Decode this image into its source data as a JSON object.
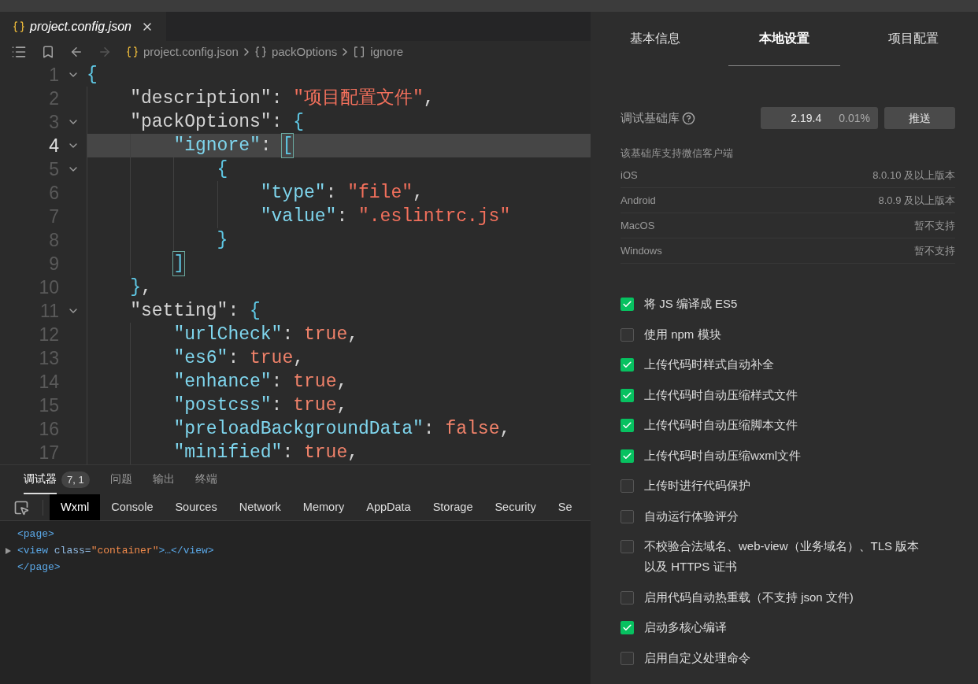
{
  "editor": {
    "tab": {
      "label": "project.config.json",
      "selected": true
    },
    "breadcrumb": [
      {
        "kind": "file",
        "label": "project.config.json"
      },
      {
        "kind": "object",
        "label": "packOptions"
      },
      {
        "kind": "array",
        "label": "ignore"
      }
    ],
    "lines": [
      {
        "number": "1",
        "foldable": true,
        "current": false,
        "tokens": [
          {
            "kind": "brace",
            "text": "{"
          }
        ],
        "children": [
          {
            "number": "2",
            "foldable": false,
            "current": false,
            "tokens": [
              {
                "kind": "key",
                "text": "\"description\""
              },
              {
                "kind": "punct",
                "text": ": "
              },
              {
                "kind": "string",
                "text": "\"项目配置文件\""
              },
              {
                "kind": "punct",
                "text": ","
              }
            ]
          },
          {
            "number": "3",
            "foldable": true,
            "current": false,
            "tokens": [
              {
                "kind": "key",
                "text": "\"packOptions\""
              },
              {
                "kind": "punct",
                "text": ": "
              },
              {
                "kind": "brace",
                "text": "{"
              }
            ],
            "children": [
              {
                "number": "4",
                "foldable": true,
                "current": true,
                "tokens": [
                  {
                    "kind": "prop",
                    "text": "\"ignore\""
                  },
                  {
                    "kind": "punct",
                    "text": ": "
                  },
                  {
                    "kind": "match",
                    "text": "["
                  }
                ],
                "children": [
                  {
                    "number": "5",
                    "foldable": true,
                    "current": false,
                    "tokens": [
                      {
                        "kind": "brace",
                        "text": "{"
                      }
                    ],
                    "children": [
                      {
                        "number": "6",
                        "foldable": false,
                        "current": false,
                        "tokens": [
                          {
                            "kind": "prop",
                            "text": "\"type\""
                          },
                          {
                            "kind": "punct",
                            "text": ": "
                          },
                          {
                            "kind": "string",
                            "text": "\"file\""
                          },
                          {
                            "kind": "punct",
                            "text": ","
                          }
                        ]
                      },
                      {
                        "number": "7",
                        "foldable": false,
                        "current": false,
                        "tokens": [
                          {
                            "kind": "prop",
                            "text": "\"value\""
                          },
                          {
                            "kind": "punct",
                            "text": ": "
                          },
                          {
                            "kind": "string",
                            "text": "\".eslintrc.js\""
                          }
                        ]
                      }
                    ]
                  },
                  {
                    "number": "8",
                    "foldable": false,
                    "current": false,
                    "tokens": [
                      {
                        "kind": "brace",
                        "text": "}"
                      }
                    ]
                  }
                ]
              },
              {
                "number": "9",
                "foldable": false,
                "current": false,
                "tokens": [
                  {
                    "kind": "match",
                    "text": "]"
                  }
                ]
              }
            ]
          },
          {
            "number": "10",
            "foldable": false,
            "current": false,
            "tokens": [
              {
                "kind": "brace",
                "text": "}"
              },
              {
                "kind": "punct",
                "text": ","
              }
            ]
          },
          {
            "number": "11",
            "foldable": true,
            "current": false,
            "tokens": [
              {
                "kind": "key",
                "text": "\"setting\""
              },
              {
                "kind": "punct",
                "text": ": "
              },
              {
                "kind": "brace",
                "text": "{"
              }
            ],
            "children": [
              {
                "number": "12",
                "foldable": false,
                "current": false,
                "tokens": [
                  {
                    "kind": "prop",
                    "text": "\"urlCheck\""
                  },
                  {
                    "kind": "punct",
                    "text": ": "
                  },
                  {
                    "kind": "bool",
                    "text": "true"
                  },
                  {
                    "kind": "punct",
                    "text": ","
                  }
                ]
              },
              {
                "number": "13",
                "foldable": false,
                "current": false,
                "tokens": [
                  {
                    "kind": "prop",
                    "text": "\"es6\""
                  },
                  {
                    "kind": "punct",
                    "text": ": "
                  },
                  {
                    "kind": "bool",
                    "text": "true"
                  },
                  {
                    "kind": "punct",
                    "text": ","
                  }
                ]
              },
              {
                "number": "14",
                "foldable": false,
                "current": false,
                "tokens": [
                  {
                    "kind": "prop",
                    "text": "\"enhance\""
                  },
                  {
                    "kind": "punct",
                    "text": ": "
                  },
                  {
                    "kind": "bool",
                    "text": "true"
                  },
                  {
                    "kind": "punct",
                    "text": ","
                  }
                ]
              },
              {
                "number": "15",
                "foldable": false,
                "current": false,
                "tokens": [
                  {
                    "kind": "prop",
                    "text": "\"postcss\""
                  },
                  {
                    "kind": "punct",
                    "text": ": "
                  },
                  {
                    "kind": "bool",
                    "text": "true"
                  },
                  {
                    "kind": "punct",
                    "text": ","
                  }
                ]
              },
              {
                "number": "16",
                "foldable": false,
                "current": false,
                "tokens": [
                  {
                    "kind": "prop",
                    "text": "\"preloadBackgroundData\""
                  },
                  {
                    "kind": "punct",
                    "text": ": "
                  },
                  {
                    "kind": "bool",
                    "text": "false"
                  },
                  {
                    "kind": "punct",
                    "text": ","
                  }
                ]
              },
              {
                "number": "17",
                "foldable": false,
                "current": false,
                "tokens": [
                  {
                    "kind": "prop",
                    "text": "\"minified\""
                  },
                  {
                    "kind": "punct",
                    "text": ": "
                  },
                  {
                    "kind": "bool",
                    "text": "true"
                  },
                  {
                    "kind": "punct",
                    "text": ","
                  }
                ]
              }
            ]
          }
        ]
      }
    ]
  },
  "bottom_panel": {
    "tabs": [
      {
        "label": "调试器",
        "selected": true,
        "badge": "7, 1"
      },
      {
        "label": "问题",
        "selected": false
      },
      {
        "label": "输出",
        "selected": false
      },
      {
        "label": "终端",
        "selected": false
      }
    ],
    "devtools_tabs": [
      {
        "label": "Wxml",
        "selected": true
      },
      {
        "label": "Console",
        "selected": false
      },
      {
        "label": "Sources",
        "selected": false
      },
      {
        "label": "Network",
        "selected": false
      },
      {
        "label": "Memory",
        "selected": false
      },
      {
        "label": "AppData",
        "selected": false
      },
      {
        "label": "Storage",
        "selected": false
      },
      {
        "label": "Security",
        "selected": false
      },
      {
        "label": "Se",
        "selected": false
      }
    ],
    "wxml": [
      {
        "expandable": false,
        "tokens": [
          {
            "kind": "tag",
            "text": "<page>"
          }
        ]
      },
      {
        "expandable": true,
        "expanded": false,
        "tokens": [
          {
            "kind": "tag",
            "text": "<view"
          },
          {
            "kind": "attr",
            "text": " class="
          },
          {
            "kind": "value",
            "text": "\"container\""
          },
          {
            "kind": "tag",
            "text": ">…</view>"
          }
        ]
      },
      {
        "expandable": false,
        "tokens": [
          {
            "kind": "tag",
            "text": "</page>"
          }
        ]
      }
    ]
  },
  "settings": {
    "tabs": [
      {
        "label": "基本信息",
        "selected": false
      },
      {
        "label": "本地设置",
        "selected": true
      },
      {
        "label": "项目配置",
        "selected": false
      }
    ],
    "debug_library": {
      "label": "调试基础库",
      "version": "2.19.4",
      "share": "0.01%",
      "button": "推送"
    },
    "support_note": "该基础库支持微信客户端",
    "clients": [
      {
        "name": "iOS",
        "version": "8.0.10 及以上版本"
      },
      {
        "name": "Android",
        "version": "8.0.9 及以上版本"
      },
      {
        "name": "MacOS",
        "version": "暂不支持"
      },
      {
        "name": "Windows",
        "version": "暂不支持"
      }
    ],
    "options": [
      {
        "label": "将 JS 编译成 ES5",
        "checked": true
      },
      {
        "label": "使用 npm 模块",
        "checked": false
      },
      {
        "label": "上传代码时样式自动补全",
        "checked": true
      },
      {
        "label": "上传代码时自动压缩样式文件",
        "checked": true
      },
      {
        "label": "上传代码时自动压缩脚本文件",
        "checked": true
      },
      {
        "label": "上传代码时自动压缩wxml文件",
        "checked": true
      },
      {
        "label": "上传时进行代码保护",
        "checked": false
      },
      {
        "label": "自动运行体验评分",
        "checked": false
      },
      {
        "label": "不校验合法域名、web-view（业务域名）、TLS 版本以及 HTTPS 证书",
        "checked": false
      },
      {
        "label": "启用代码自动热重载（不支持 json 文件)",
        "checked": false
      },
      {
        "label": "启动多核心编译",
        "checked": true
      },
      {
        "label": "启用自定义处理命令",
        "checked": false
      }
    ]
  }
}
